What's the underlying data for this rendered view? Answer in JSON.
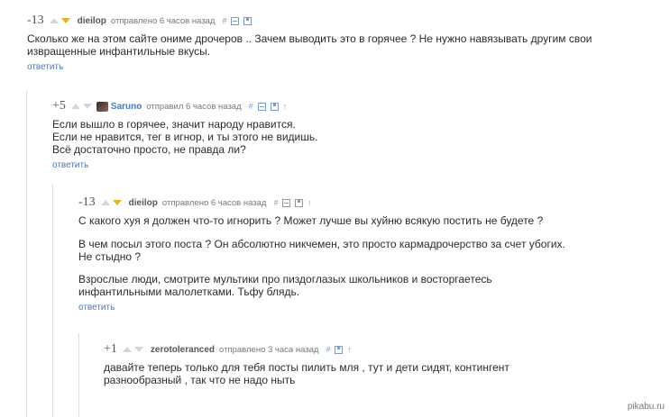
{
  "comments": [
    {
      "rating": "-13",
      "author": "dieilop",
      "meta": "отправлено 6 часов назад",
      "body": [
        "Сколько же на этом сайте ониме дрочеров .. Зачем выводить это в горячее ? Не нужно навязывать другим свои\nизвращенные инфантильные вкусы."
      ],
      "reply": "ответить"
    },
    {
      "rating": "+5",
      "author": "Saruno",
      "meta": "отправил 6 часов назад",
      "body": [
        "Если вышло в горячее, значит народу нравится.\nЕсли не нравится, тег в игнор, и ты этого не видишь.\nВсё достаточно просто, не правда ли?"
      ],
      "reply": "ответить"
    },
    {
      "rating": "-13",
      "author": "dieilop",
      "meta": "отправлено 6 часов назад",
      "body": [
        "С какого хуя я должен что-то игнорить ? Может лучше вы хуйню всякую постить не будете ?",
        "В чем посыл этого поста ? Он абсолютно никчемен, это просто кармадрочерство за счет убогих.\nНе стыдно ?",
        "Взрослые люди, смотрите мультики про пиздоглазых школьников и восторгаетесь\nинфантильными малолетками. Тьфу блядь."
      ],
      "reply": "ответить"
    },
    {
      "rating": "+1",
      "author": "zerotoleranced",
      "meta": "отправлено 3 часа назад",
      "body": [
        "давайте теперь только для тебя посты пилить мля , тут и дети сидят, контингент\nразнообразный , так что не надо ныть"
      ],
      "reply": ""
    }
  ],
  "actions": {
    "link": "#",
    "up": "↑"
  },
  "watermark": "pikabu.ru"
}
